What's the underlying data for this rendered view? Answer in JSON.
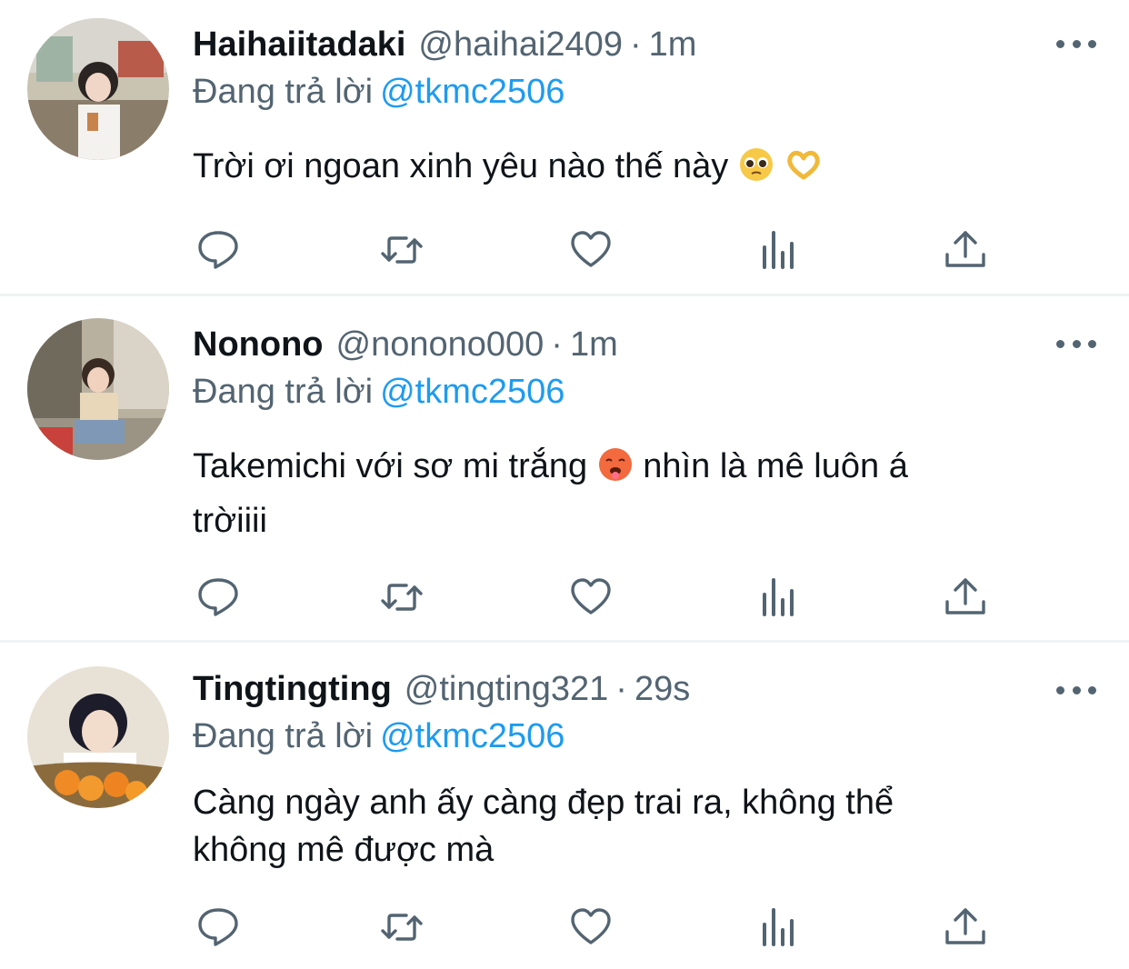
{
  "tweets": [
    {
      "display_name": "Haihaiitadaki",
      "handle": "@haihai2409",
      "separator": "·",
      "time": "1m",
      "reply_prefix": "Đang trả lời",
      "reply_to": "@tkmc2506",
      "text": "Trời ơi ngoan xinh yêu nào thế này",
      "emojis": [
        "pleading-face-emoji",
        "heart-hands-emoji"
      ]
    },
    {
      "display_name": "Nonono",
      "handle": "@nonono000",
      "separator": "·",
      "time": "1m",
      "reply_prefix": "Đang trả lời",
      "reply_to": "@tkmc2506",
      "text_before": "Takemichi với sơ mi trắng",
      "text_after": "nhìn là mê luôn á",
      "text_line2": "trờiiii",
      "emojis": [
        "hot-face-emoji"
      ]
    },
    {
      "display_name": "Tingtingting",
      "handle": "@tingting321",
      "separator": "·",
      "time": "29s",
      "reply_prefix": "Đang trả lời",
      "reply_to": "@tkmc2506",
      "text_line1": "Càng ngày anh ấy càng đẹp trai ra, không thể",
      "text_line2": "không mê được mà"
    }
  ],
  "action_icons": [
    "reply-icon",
    "retweet-icon",
    "like-icon",
    "analytics-icon",
    "share-icon"
  ],
  "colors": {
    "text": "#0f1419",
    "secondary": "#536471",
    "mention": "#1d9bf0",
    "divider": "#eff3f4"
  }
}
